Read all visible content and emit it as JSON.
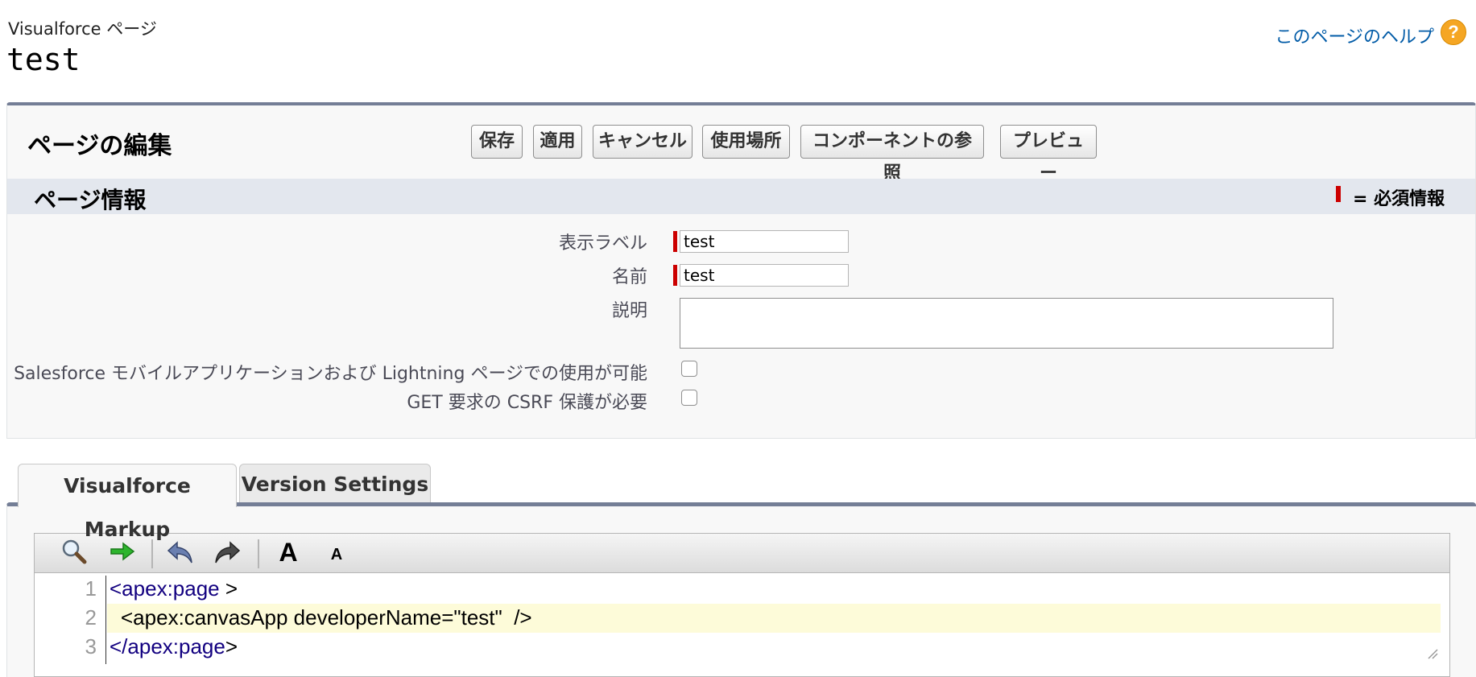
{
  "header": {
    "breadcrumb": "Visualforce ページ",
    "title": "test",
    "help_link": "このページのヘルプ",
    "help_icon": "?"
  },
  "edit_section": {
    "title": "ページの編集",
    "buttons": {
      "save": "保存",
      "apply": "適用",
      "cancel": "キャンセル",
      "where_used": "使用場所",
      "component_ref": "コンポーネントの参照",
      "preview": "プレビュー"
    }
  },
  "page_info": {
    "title": "ページ情報",
    "required_legend": "= 必須情報",
    "fields": {
      "label_label": "表示ラベル",
      "label_value": "test",
      "name_label": "名前",
      "name_value": "test",
      "description_label": "説明",
      "description_value": "",
      "mobile_label": "Salesforce モバイルアプリケーションおよび Lightning ページでの使用が可能",
      "mobile_checked": false,
      "csrf_label": "GET 要求の CSRF 保護が必要",
      "csrf_checked": false
    }
  },
  "tabs": {
    "markup": "Visualforce Markup",
    "version": "Version Settings",
    "active": "Visualforce Markup"
  },
  "toolbar": {
    "icons": [
      "search-icon",
      "go-to-line-icon",
      "undo-icon",
      "redo-icon",
      "font-larger-icon",
      "font-smaller-icon"
    ],
    "large_font_glyph": "A",
    "small_font_glyph": "A"
  },
  "code": {
    "line_numbers": [
      "1",
      "2",
      "3"
    ],
    "line1_tag": "<apex:page",
    "line1_rest": " >",
    "line2_tag": "<apex:canvasApp",
    "line2_rest": " developerName=\"test\"  />",
    "line3_tag": "</apex:page",
    "line3_rest": ">"
  },
  "colors": {
    "accent": "#747e96",
    "required": "#cc0000",
    "link": "#015ba7",
    "tag": "#120080",
    "highlight": "#fdfbd9"
  }
}
